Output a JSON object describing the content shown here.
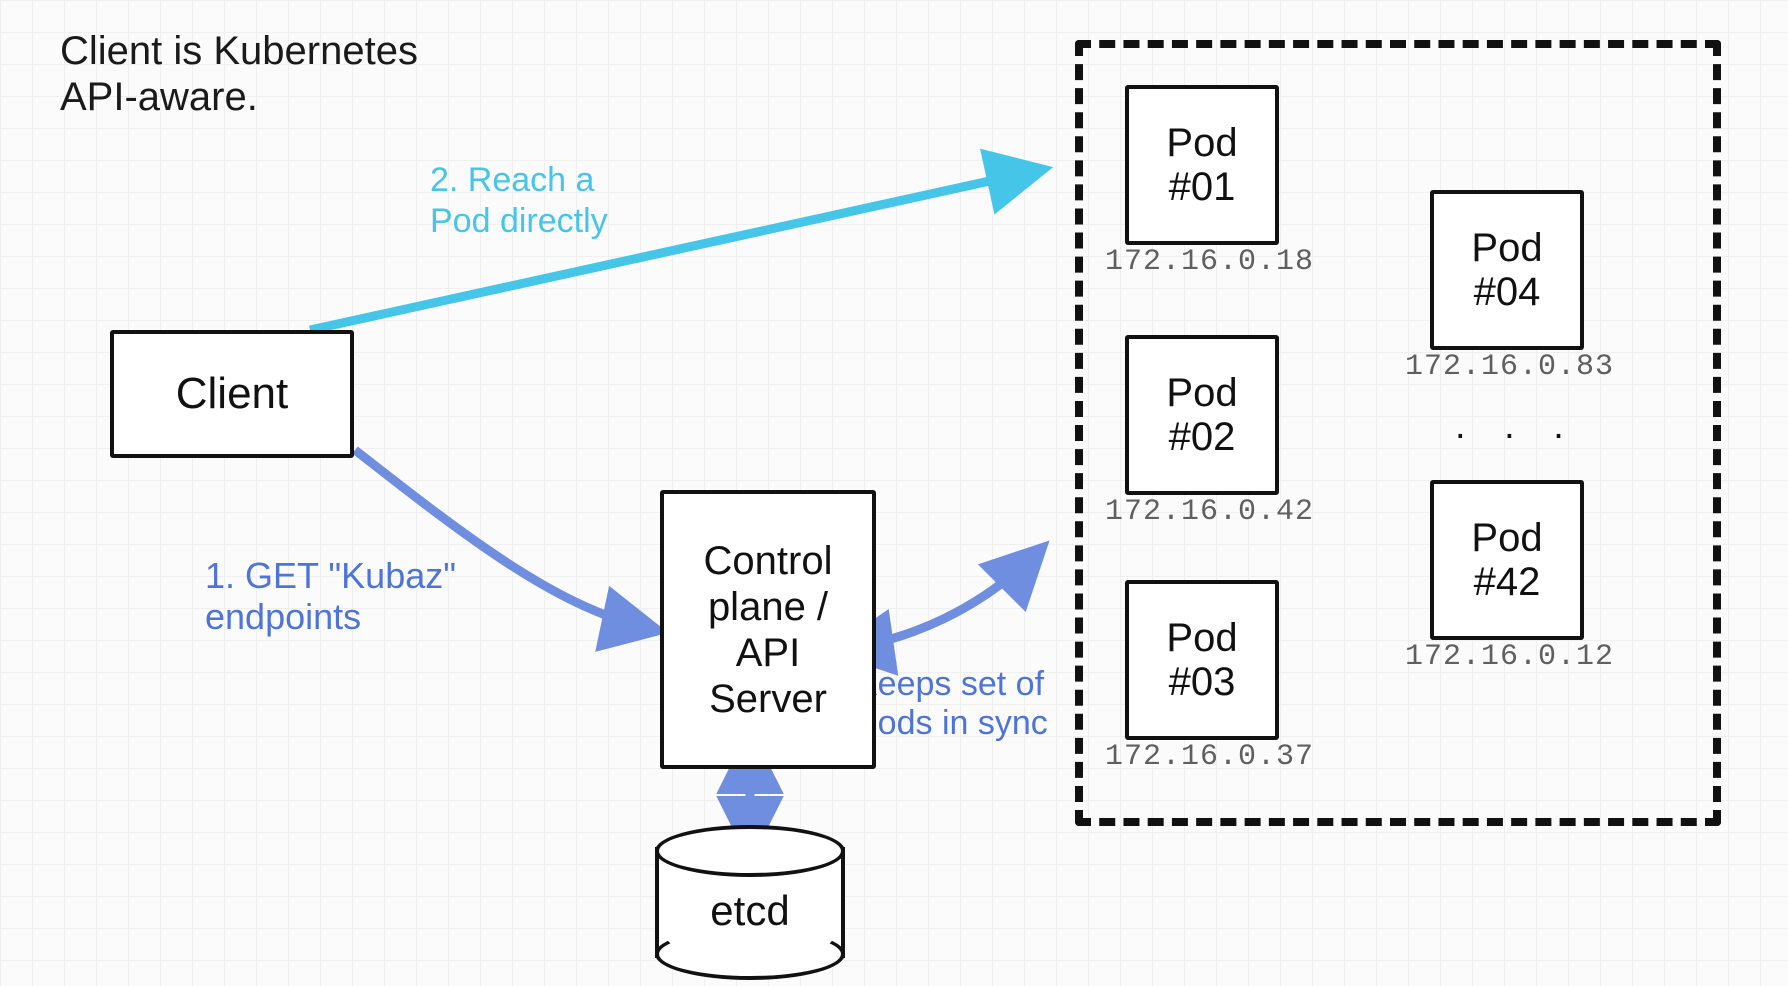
{
  "heading": "Client is Kubernetes\nAPI-aware.",
  "client_label": "Client",
  "control_plane_label": "Control\nplane /\nAPI\nServer",
  "etcd_label": "etcd",
  "arrows": {
    "reach_pod": "2. Reach a\nPod directly",
    "get_endpoints": "1. GET \"Kubaz\"\nendpoints",
    "sync": "Keeps set of\nPods in sync"
  },
  "pods": [
    {
      "name": "Pod\n#01",
      "ip": "172.16.0.18"
    },
    {
      "name": "Pod\n#02",
      "ip": "172.16.0.42"
    },
    {
      "name": "Pod\n#03",
      "ip": "172.16.0.37"
    },
    {
      "name": "Pod\n#04",
      "ip": "172.16.0.83"
    },
    {
      "name": "Pod\n#42",
      "ip": "172.16.0.12"
    }
  ],
  "ellipsis": ". . ."
}
